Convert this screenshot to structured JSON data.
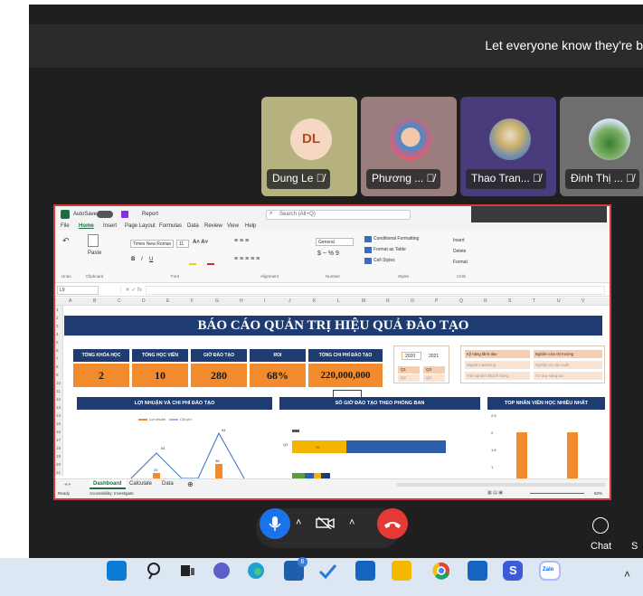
{
  "banner": {
    "text": "Let everyone know they're b"
  },
  "participants": [
    {
      "name": "Dung Le",
      "initials": "DL"
    },
    {
      "name": "Phương ..."
    },
    {
      "name": "Thao Tran..."
    },
    {
      "name": "Đinh Thị ..."
    }
  ],
  "excel": {
    "autosave": "AutoSave",
    "autosave_state": "Off",
    "file_name": "Report",
    "search_placeholder": "Search (Alt+Q)",
    "menu": [
      "File",
      "Home",
      "Insert",
      "Page Layout",
      "Formulas",
      "Data",
      "Review",
      "View",
      "Help"
    ],
    "ribbon": {
      "font_name": "Times New Roman",
      "font_size": "11",
      "number_format": "General",
      "conditional_formatting": "Conditional Formatting",
      "format_as_table": "Format as Table",
      "cell_styles": "Cell Styles",
      "insert": "Insert",
      "delete": "Delete",
      "format": "Format",
      "groups": [
        "Undo",
        "Clipboard",
        "Font",
        "Alignment",
        "Number",
        "Styles",
        "Cells"
      ]
    },
    "name_box": "L9",
    "columns": [
      "A",
      "B",
      "C",
      "D",
      "E",
      "F",
      "G",
      "H",
      "I",
      "J",
      "K",
      "L",
      "M",
      "N",
      "O",
      "P",
      "Q",
      "R",
      "S",
      "T",
      "U",
      "V"
    ],
    "rows": [
      "1",
      "2",
      "3",
      "4",
      "5",
      "6",
      "7",
      "8",
      "9",
      "10",
      "11",
      "12",
      "13",
      "14",
      "15",
      "16",
      "17",
      "18",
      "19",
      "20",
      "21"
    ],
    "dashboard": {
      "title": "BÁO CÁO QUẢN TRỊ HIỆU QUẢ ĐÀO TẠO",
      "kpis": [
        {
          "label": "TỔNG KHÓA HỌC",
          "value": "2"
        },
        {
          "label": "TỔNG HỌC VIÊN",
          "value": "10"
        },
        {
          "label": "GIỜ ĐÀO TẠO",
          "value": "280"
        },
        {
          "label": "ROI",
          "value": "68%"
        },
        {
          "label": "TỔNG CHI PHÍ ĐÀO TẠO",
          "value": "220,000,000"
        }
      ],
      "year_slicer": [
        "2020",
        "2021"
      ],
      "quarter_slicer": [
        "Q1",
        "Q3",
        "Q2",
        "Q4"
      ],
      "skills_slicer": [
        "Kỹ năng lãnh đạo",
        "Nghiên cứu thị trường",
        "Digital marketing",
        "Nghiệp vụ căn xuất",
        "Trải nghiệm khách hàng",
        "Tư duy sáng tạo"
      ],
      "panels": [
        {
          "title": "LỢI NHUẬN VÀ CHI PHÍ ĐÀO TẠO",
          "legend": [
            "Lợi nhuận",
            "Chi phí"
          ]
        },
        {
          "title": "SỐ GIỜ ĐÀO TẠO THEO PHÒNG BAN"
        },
        {
          "title": "TOP NHÂN VIÊN HỌC NHIỀU NHẤT"
        }
      ]
    },
    "sheet_tabs": [
      "Dashboard",
      "Calculate",
      "Data"
    ],
    "status": {
      "ready": "Ready",
      "accessibility": "Accessibility: Investigate",
      "zoom": "62%"
    }
  },
  "chart_data": [
    {
      "type": "line",
      "title": "LỢI NHUẬN VÀ CHI PHÍ ĐÀO TẠO",
      "series": [
        {
          "name": "Lợi nhuận",
          "type": "bar"
        },
        {
          "name": "Chi phí",
          "type": "line"
        }
      ],
      "data_labels": [
        "54",
        "54",
        "20",
        "38"
      ]
    },
    {
      "type": "bar",
      "title": "SỐ GIỜ ĐÀO TẠO THEO PHÒNG BAN",
      "categories": [
        "Q3"
      ],
      "data_labels": [
        "70"
      ]
    },
    {
      "type": "bar",
      "title": "TOP NHÂN VIÊN HỌC NHIỀU NHẤT",
      "y_ticks": [
        "2.5",
        "2",
        "1.5",
        "1"
      ]
    }
  ],
  "controls": {
    "chat_label": "Chat"
  }
}
